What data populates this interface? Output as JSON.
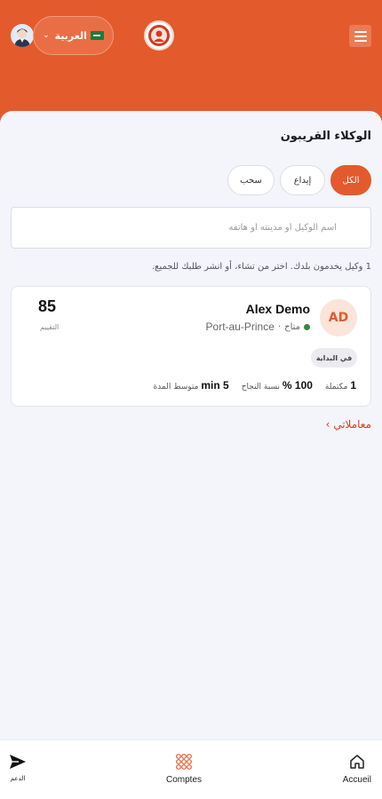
{
  "header": {
    "language_label": "العربية",
    "flag_icon": "saudi-flag-icon",
    "colors": {
      "brand": "#e35a2c"
    }
  },
  "agents": {
    "title": "الوكلاء القريبون",
    "filters": [
      {
        "label": "الكل",
        "active": true
      },
      {
        "label": "إيداع",
        "active": false
      },
      {
        "label": "سحب",
        "active": false
      }
    ],
    "search_placeholder": "اسم الوكيل أو مدينته أو هاتفه",
    "info_text": "1 وكيل يخدمون بلدك. اختر من تشاء، أو انشر طلبك للجميع.",
    "list": [
      {
        "initials": "AD",
        "name": "Alex Demo",
        "city": "Port-au-Prince",
        "separator": "·",
        "status": "متاح",
        "status_color": "#2e8b3d",
        "score": "85",
        "score_label": "التقييم",
        "badge": "في البداية",
        "stats": {
          "completed_value": "1",
          "completed_label": "مكتملة",
          "success_value": "100 %",
          "success_label": "نسبة النجاح",
          "duration_value": "5 min",
          "duration_label": "متوسط المدة"
        }
      }
    ]
  },
  "transactions_link": "معاملاتي ›",
  "bottom_nav": [
    {
      "label": "Accueil",
      "icon": "home-icon"
    },
    {
      "label": "Comptes",
      "icon": "grid-dots-icon"
    },
    {
      "label": "الدعم",
      "icon": "send-icon"
    }
  ]
}
